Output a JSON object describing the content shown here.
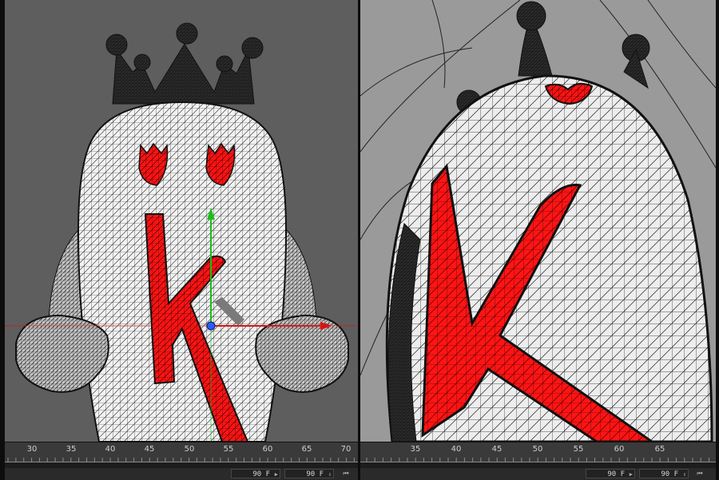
{
  "viewports": {
    "left": {
      "name": "front-view-wireframe",
      "background": "#5e5e5e"
    },
    "right": {
      "name": "perspective-closeup-wireframe",
      "background": "#9a9a9a"
    }
  },
  "model": {
    "mesh_color": "#ffffff",
    "wire_color": "#1a1a1a",
    "letter_color": "#ff1414",
    "letter": "K"
  },
  "gizmo": {
    "y_axis_color": "#19c019",
    "x_axis_color": "#d81414",
    "pivot_color": "#2a5cff"
  },
  "timeline_left": {
    "ticks": [
      "30",
      "35",
      "40",
      "45",
      "50",
      "55",
      "60",
      "65",
      "70"
    ],
    "end_frame": "90 F",
    "end_frame_2": "90 F",
    "first_button": "⏮"
  },
  "timeline_right": {
    "ticks": [
      "35",
      "40",
      "45",
      "50",
      "55",
      "60",
      "65"
    ],
    "end_frame": "90 F",
    "end_frame_2": "90 F",
    "first_button": "⏮"
  }
}
